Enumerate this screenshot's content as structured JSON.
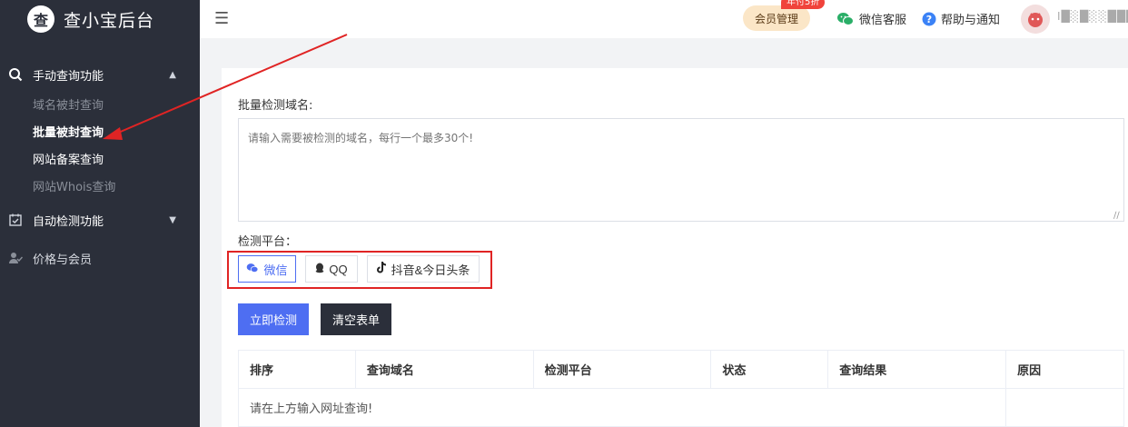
{
  "sidebar": {
    "brand_logo": "查",
    "brand_name": "查小宝后台",
    "groups": [
      {
        "label": "手动查询功能",
        "icon": "search-icon",
        "expanded": true,
        "items": [
          {
            "label": "域名被封查询"
          },
          {
            "label": "批量被封查询"
          },
          {
            "label": "网站备案查询"
          },
          {
            "label": "网站Whois查询"
          }
        ]
      },
      {
        "label": "自动检测功能",
        "icon": "calendar-check-icon",
        "expanded": false
      },
      {
        "label": "价格与会员",
        "icon": "user-check-icon"
      }
    ]
  },
  "header": {
    "menu_icon": "☰",
    "vip_label": "会员管理",
    "vip_badge": "年付5折",
    "wechat_service": "微信客服",
    "help": "帮助与通知",
    "username": "I█░█░░███░"
  },
  "main": {
    "domains_label": "批量检测域名:",
    "domains_placeholder": "请输入需要被检测的域名，每行一个最多30个!",
    "platform_label": "检测平台：",
    "platforms": [
      {
        "label": "微信",
        "icon": "wechat-icon",
        "selected": true
      },
      {
        "label": "QQ",
        "icon": "qq-icon",
        "selected": false
      },
      {
        "label": "抖音&今日头条",
        "icon": "tiktok-icon",
        "selected": false
      }
    ],
    "submit_label": "立即检测",
    "clear_label": "清空表单",
    "table": {
      "columns": [
        "排序",
        "查询域名",
        "检测平台",
        "状态",
        "查询结果",
        "原因"
      ],
      "empty_text": "请在上方输入网址查询!"
    }
  },
  "colors": {
    "sidebar_bg": "#2b2f3a",
    "primary": "#4e6ef2",
    "annotation": "#e02424",
    "vip_bg": "#fbe6c7",
    "badge": "#f0433b"
  }
}
